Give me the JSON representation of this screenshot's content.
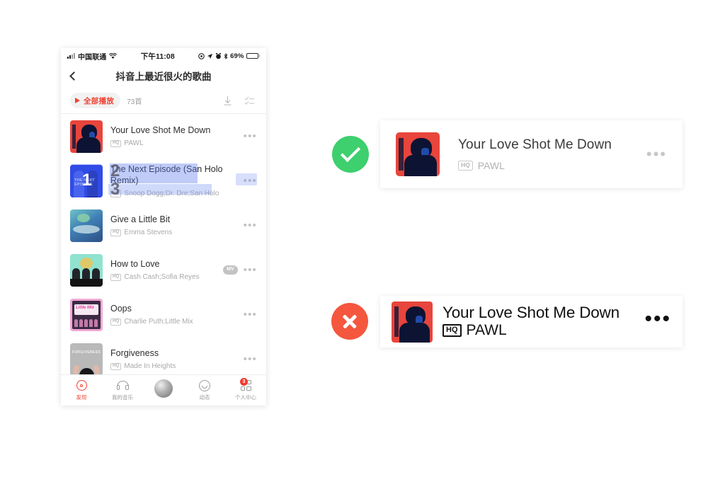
{
  "phone": {
    "status_bar": {
      "carrier": "中国联通",
      "wifi_icon": "wifi-icon",
      "time": "下午11:08",
      "location_icon": "location-icon",
      "navigation_icon": "navigation-arrow-icon",
      "alarm_icon": "alarm-icon",
      "bluetooth_icon": "bluetooth-icon",
      "battery_percent": "69%"
    },
    "nav": {
      "back_icon": "back-chevron-icon",
      "title": "抖音上最近很火的歌曲"
    },
    "toolbar": {
      "play_all_label": "全部播放",
      "count_label": "73首",
      "download_icon": "download-icon",
      "multiselect_icon": "multi-select-icon"
    },
    "songs": [
      {
        "title": "Your Love Shot Me Down",
        "quality": "HQ",
        "artist": "PAWL",
        "more_icon": "more-dots-icon",
        "art": "pawl"
      },
      {
        "title": "The Next Episode (San Holo Remix)",
        "quality": "HQ",
        "artist": "Snoop Dogg;Dr. Dre;San Holo",
        "more_icon": "more-dots-icon",
        "art": "next-episode",
        "selected": true,
        "markers": [
          "1",
          "2",
          "3"
        ]
      },
      {
        "title": "Give a Little Bit",
        "quality": "HQ",
        "artist": "Emma Stevens",
        "more_icon": "more-dots-icon",
        "art": "give"
      },
      {
        "title": "How to Love",
        "quality": "HQ",
        "artist": "Cash Cash;Sofia Reyes",
        "mv_badge": "MV",
        "more_icon": "more-dots-icon",
        "art": "how"
      },
      {
        "title": "Oops",
        "quality": "HQ",
        "artist": "Charlie Puth;Little Mix",
        "more_icon": "more-dots-icon",
        "art": "oops"
      },
      {
        "title": "Forgiveness",
        "quality": "HQ",
        "artist": "Made In Heights",
        "more_icon": "more-dots-icon",
        "art": "forgiveness",
        "art_label": "FORGIVENESS"
      }
    ],
    "tabs": [
      {
        "label": "发现",
        "icon": "discover-icon",
        "active": true
      },
      {
        "label": "我的音乐",
        "icon": "headphones-icon",
        "active": false
      },
      {
        "label": "",
        "icon": "avatar-icon",
        "active": false
      },
      {
        "label": "动态",
        "icon": "smiley-icon",
        "active": false
      },
      {
        "label": "个人中心",
        "icon": "grid-icon",
        "active": false,
        "badge": "3"
      }
    ]
  },
  "examples": {
    "good": {
      "status_icon": "check-circle-icon",
      "status_color": "#3ECF6E",
      "title": "Your Love Shot Me Down",
      "quality": "HQ",
      "artist": "PAWL",
      "more_icon": "more-dots-icon"
    },
    "bad": {
      "status_icon": "x-circle-icon",
      "status_color": "#F4573E",
      "title": "Your Love Shot Me Down",
      "quality": "HQ",
      "artist": "PAWL",
      "more_icon": "more-dots-icon"
    }
  }
}
